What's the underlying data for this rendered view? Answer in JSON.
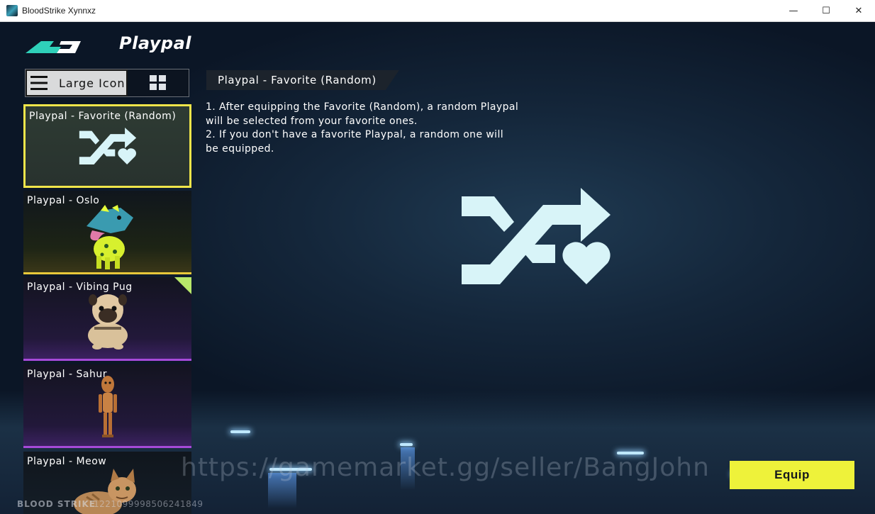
{
  "window": {
    "title": "BloodStrike Xynnxz",
    "minimize_glyph": "—",
    "maximize_glyph": "☐",
    "close_glyph": "✕"
  },
  "header": {
    "title": "Playpal"
  },
  "view_toggle": {
    "large_icon_label": "Large Icon",
    "selected": "Large Icon"
  },
  "playpals": [
    {
      "name": "Playpal - Favorite (Random)",
      "rarity_color": "#f0e54a",
      "selected": true
    },
    {
      "name": "Playpal - Oslo",
      "rarity_color": "#e8c83a"
    },
    {
      "name": "Playpal - Vibing Pug",
      "rarity_color": "#a64ad9",
      "new": true
    },
    {
      "name": "Playpal - Sahur",
      "rarity_color": "#a64ad9"
    },
    {
      "name": "Playpal - Meow"
    }
  ],
  "detail": {
    "title": "Playpal - Favorite (Random)",
    "description_lines": [
      "1. After equipping the Favorite (Random), a random Playpal",
      "will be selected from your favorite ones.",
      "2. If you don't have a favorite Playpal, a random one will",
      "be equipped."
    ]
  },
  "equip_label": "Equip",
  "watermark": "https://gamemarket.gg/seller/BangJohn",
  "footer": {
    "brand": "BLOOD STRIKE",
    "uid": "1221099998506241849"
  },
  "colors": {
    "accent_yellow": "#eef23a",
    "icon_color": "#d8f4f8"
  }
}
